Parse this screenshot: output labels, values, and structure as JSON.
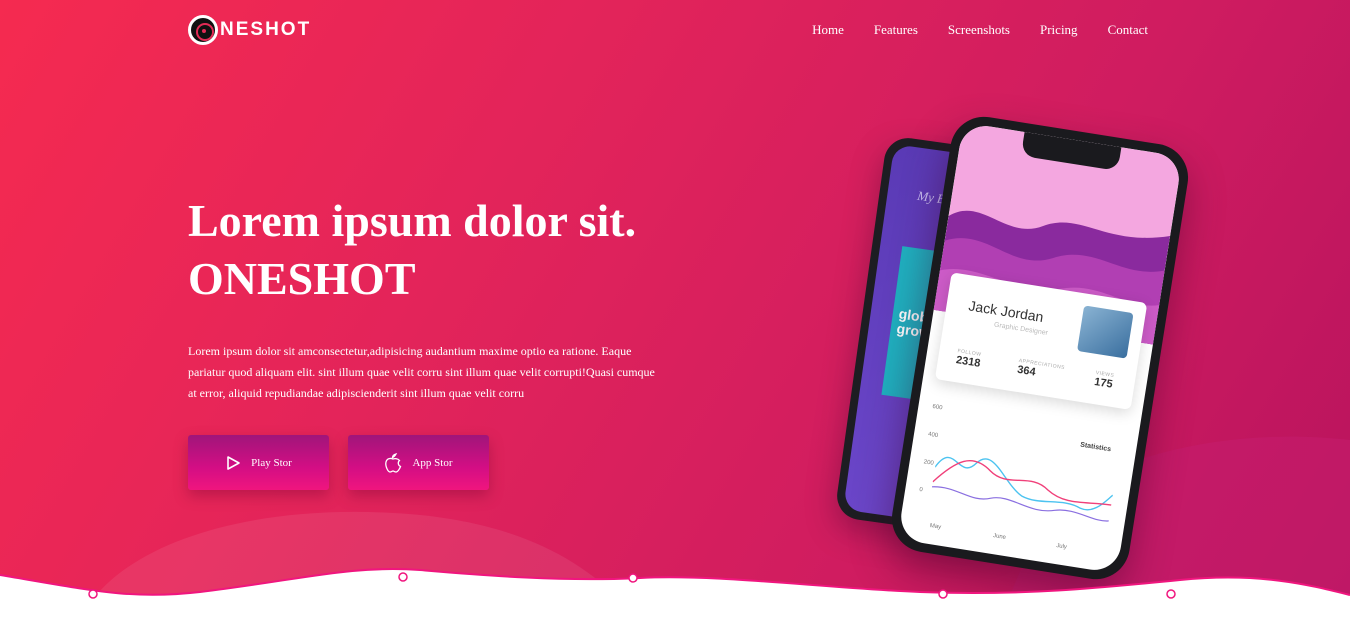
{
  "brand": {
    "logo_text": "NESHOT"
  },
  "nav": {
    "items": [
      "Home",
      "Features",
      "Screenshots",
      "Pricing",
      "Contact"
    ]
  },
  "hero": {
    "headline_line1": "Lorem ipsum dolor sit.",
    "headline_line2": "ONESHOT",
    "description": "Lorem ipsum dolor sit amconsectetur,adipisicing audantium maxime optio ea ratione. Eaque pariatur quod aliquam elit. sint illum quae velit corru sint illum quae velit corrupti!Quasi cumque at error, aliquid repudiandae adipiscienderit sint illum quae velit corru",
    "buttons": {
      "play_store": "Play Stor",
      "app_store": "App Stor"
    }
  },
  "mockup": {
    "back_screen": {
      "title": "My Book",
      "book_text": "global growth"
    },
    "front_screen": {
      "profile_name": "Jack Jordan",
      "profile_role": "Graphic Designer",
      "stats": [
        {
          "label": "FOLLOW",
          "value": "2318"
        },
        {
          "label": "APPRECIATIONS",
          "value": "364"
        },
        {
          "label": "VIEWS",
          "value": "175"
        }
      ],
      "chart_title": "Statistics",
      "chart_y_labels": [
        "600",
        "400",
        "200",
        "0"
      ],
      "chart_x_labels": [
        "May",
        "June",
        "July"
      ]
    }
  },
  "colors": {
    "accent_pink": "#e3245a",
    "button_magenta": "#d40e84",
    "wave_white": "#ffffff"
  }
}
